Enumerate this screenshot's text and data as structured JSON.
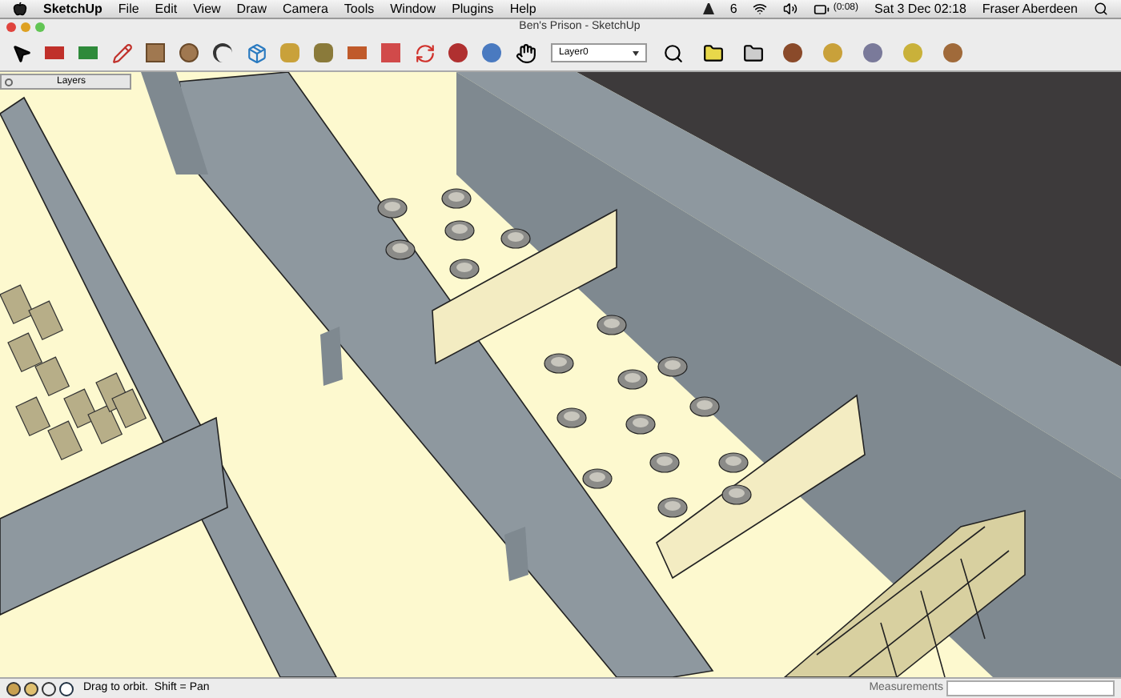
{
  "menubar": {
    "app": "SketchUp",
    "menus": [
      "File",
      "Edit",
      "View",
      "Draw",
      "Camera",
      "Tools",
      "Window",
      "Plugins",
      "Help"
    ],
    "status_items": [
      "6",
      "(0:08)",
      "Sat 3 Dec  02:18",
      "Fraser Aberdeen"
    ]
  },
  "window": {
    "title": "Ben's Prison - SketchUp"
  },
  "toolbar": {
    "layer_select": "Layer0"
  },
  "layers_panel": {
    "title": "Layers"
  },
  "status_bar": {
    "hint": "Drag to orbit.  Shift = Pan",
    "measurements_label": "Measurements"
  }
}
